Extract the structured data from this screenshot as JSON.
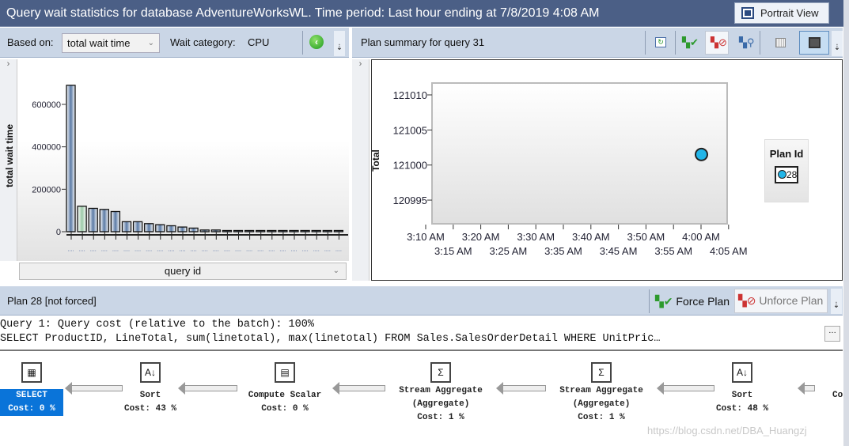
{
  "title": "Query wait statistics for database AdventureWorksWL. Time period: Last hour ending at 7/8/2019 4:08 AM",
  "portrait_view": "Portrait View",
  "left_toolbar": {
    "based_on_label": "Based on:",
    "based_on_value": "total wait time",
    "wait_category_label": "Wait category:",
    "wait_category_value": "CPU"
  },
  "right_toolbar": {
    "title": "Plan summary for query 31",
    "icons": [
      "refresh-icon",
      "force-plan-icon",
      "unforce-plan-icon",
      "compare-plans-icon",
      "grid-view-icon",
      "chart-view-icon"
    ]
  },
  "chart_data": [
    {
      "type": "bar",
      "ylabel": "total wait time",
      "xlabel": "query id",
      "ylim": [
        0,
        700000
      ],
      "yticks": [
        "0",
        "200000",
        "400000",
        "600000"
      ],
      "values": [
        690000,
        120000,
        110000,
        105000,
        95000,
        47000,
        47000,
        38000,
        33000,
        28000,
        22000,
        17000,
        8000,
        8000,
        1000,
        0,
        0,
        0,
        0,
        0,
        0,
        0,
        0,
        0,
        0
      ],
      "highlight_index": 1,
      "colors": {
        "bar": "#5a7aa5",
        "highlight": "#9cc9a8"
      }
    },
    {
      "type": "scatter",
      "ylabel": "Total",
      "ylim": [
        120992,
        121012
      ],
      "yticks": [
        "120995",
        "121000",
        "121005",
        "121010"
      ],
      "xticks": [
        "3:10 AM",
        "3:15 AM",
        "3:20 AM",
        "3:25 AM",
        "3:30 AM",
        "3:35 AM",
        "3:40 AM",
        "3:45 AM",
        "3:50 AM",
        "3:55 AM",
        "4:00 AM",
        "4:05 AM"
      ],
      "legend_title": "Plan Id",
      "legend_placement": "right",
      "series": [
        {
          "name": "28",
          "color": "#22b5e8",
          "points": [
            {
              "x": "4:00 AM",
              "y": 121001.5
            }
          ]
        }
      ]
    }
  ],
  "bottom_toolbar": {
    "plan_label": "Plan 28 [not forced]",
    "force_plan": "Force Plan",
    "unforce_plan": "Unforce Plan"
  },
  "query": {
    "line1": "Query 1: Query cost (relative to the batch): 100%",
    "line2": "SELECT ProductID, LineTotal, sum(linetotal), max(linetotal) FROM Sales.SalesOrderDetail WHERE UnitPric…"
  },
  "plan_ops": [
    {
      "name": "SELECT",
      "l2": "Cost: 0 %",
      "icon": "select-icon"
    },
    {
      "name": "Sort",
      "l2": "Cost: 43 %",
      "icon": "sort-icon"
    },
    {
      "name": "Compute Scalar",
      "l2": "Cost: 0 %",
      "icon": "compute-scalar-icon"
    },
    {
      "name": "Stream Aggregate",
      "l2": "(Aggregate)",
      "l3": "Cost: 1 %",
      "icon": "stream-aggregate-icon"
    },
    {
      "name": "Stream Aggregate",
      "l2": "(Aggregate)",
      "l3": "Cost: 1 %",
      "icon": "stream-aggregate-icon"
    },
    {
      "name": "Sort",
      "l2": "Cost: 48 %",
      "icon": "sort-icon"
    },
    {
      "name": "Co",
      "l2": "",
      "icon": ""
    }
  ],
  "watermark": "https://blog.csdn.net/DBA_Huangzj"
}
